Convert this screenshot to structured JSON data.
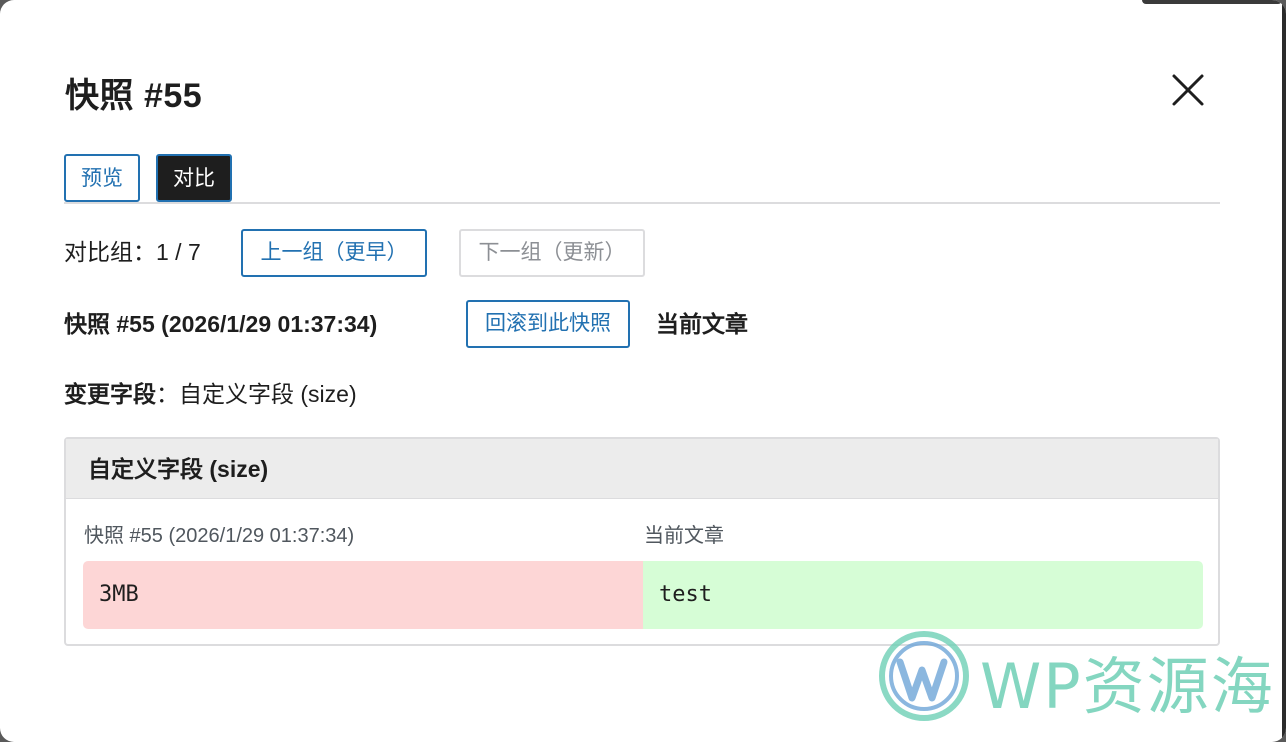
{
  "modal": {
    "title": "快照 #55",
    "close_icon": "close-icon"
  },
  "tabs": [
    {
      "label": "预览",
      "active": false
    },
    {
      "label": "对比",
      "active": true
    }
  ],
  "nav": {
    "group_label": "对比组：1 / 7",
    "prev_button": "上一组（更早）",
    "next_button": "下一组（更新）",
    "next_disabled": true
  },
  "snapshot": {
    "label": "快照 #55 (2026/1/29 01:37:34)",
    "rollback_button": "回滚到此快照",
    "current_label": "当前文章"
  },
  "changed_fields": {
    "key": "变更字段",
    "value": "：自定义字段 (size)"
  },
  "diff_card": {
    "title": "自定义字段 (size)",
    "left_header": "快照 #55 (2026/1/29 01:37:34)",
    "right_header": "当前文章",
    "old_value": "3MB",
    "new_value": "test"
  },
  "watermark": {
    "text": "WP资源海"
  },
  "colors": {
    "accent": "#2271b1",
    "removed_bg": "#fdd6d6",
    "added_bg": "#d6fdd6",
    "header_bg": "#ececec",
    "watermark": "#6fd0b6"
  }
}
